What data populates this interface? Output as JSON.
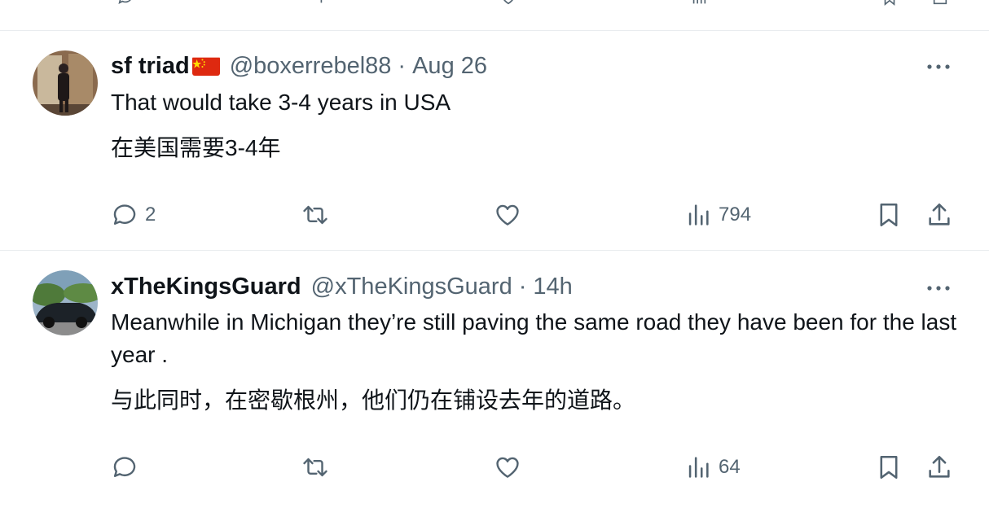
{
  "colors": {
    "text": "#0f1419",
    "muted": "#536471",
    "divider": "#e9ecef"
  },
  "tweets": [
    {
      "name": "sf triad",
      "flag": "china-flag-icon",
      "handle": "@boxerrebel88",
      "separator": "·",
      "time": "Aug 26",
      "text_en": "That would take 3-4 years in USA",
      "text_zh": "在美国需要3-4年",
      "replies": "2",
      "views": "794"
    },
    {
      "name": "xTheKingsGuard",
      "handle": "@xTheKingsGuard",
      "separator": "·",
      "time": "14h",
      "text_en": "Meanwhile in Michigan they’re still paving the same road they have been for the last year .",
      "text_zh": "与此同时，在密歇根州，他们仍在铺设去年的道路。",
      "replies": "",
      "views": "64"
    }
  ]
}
